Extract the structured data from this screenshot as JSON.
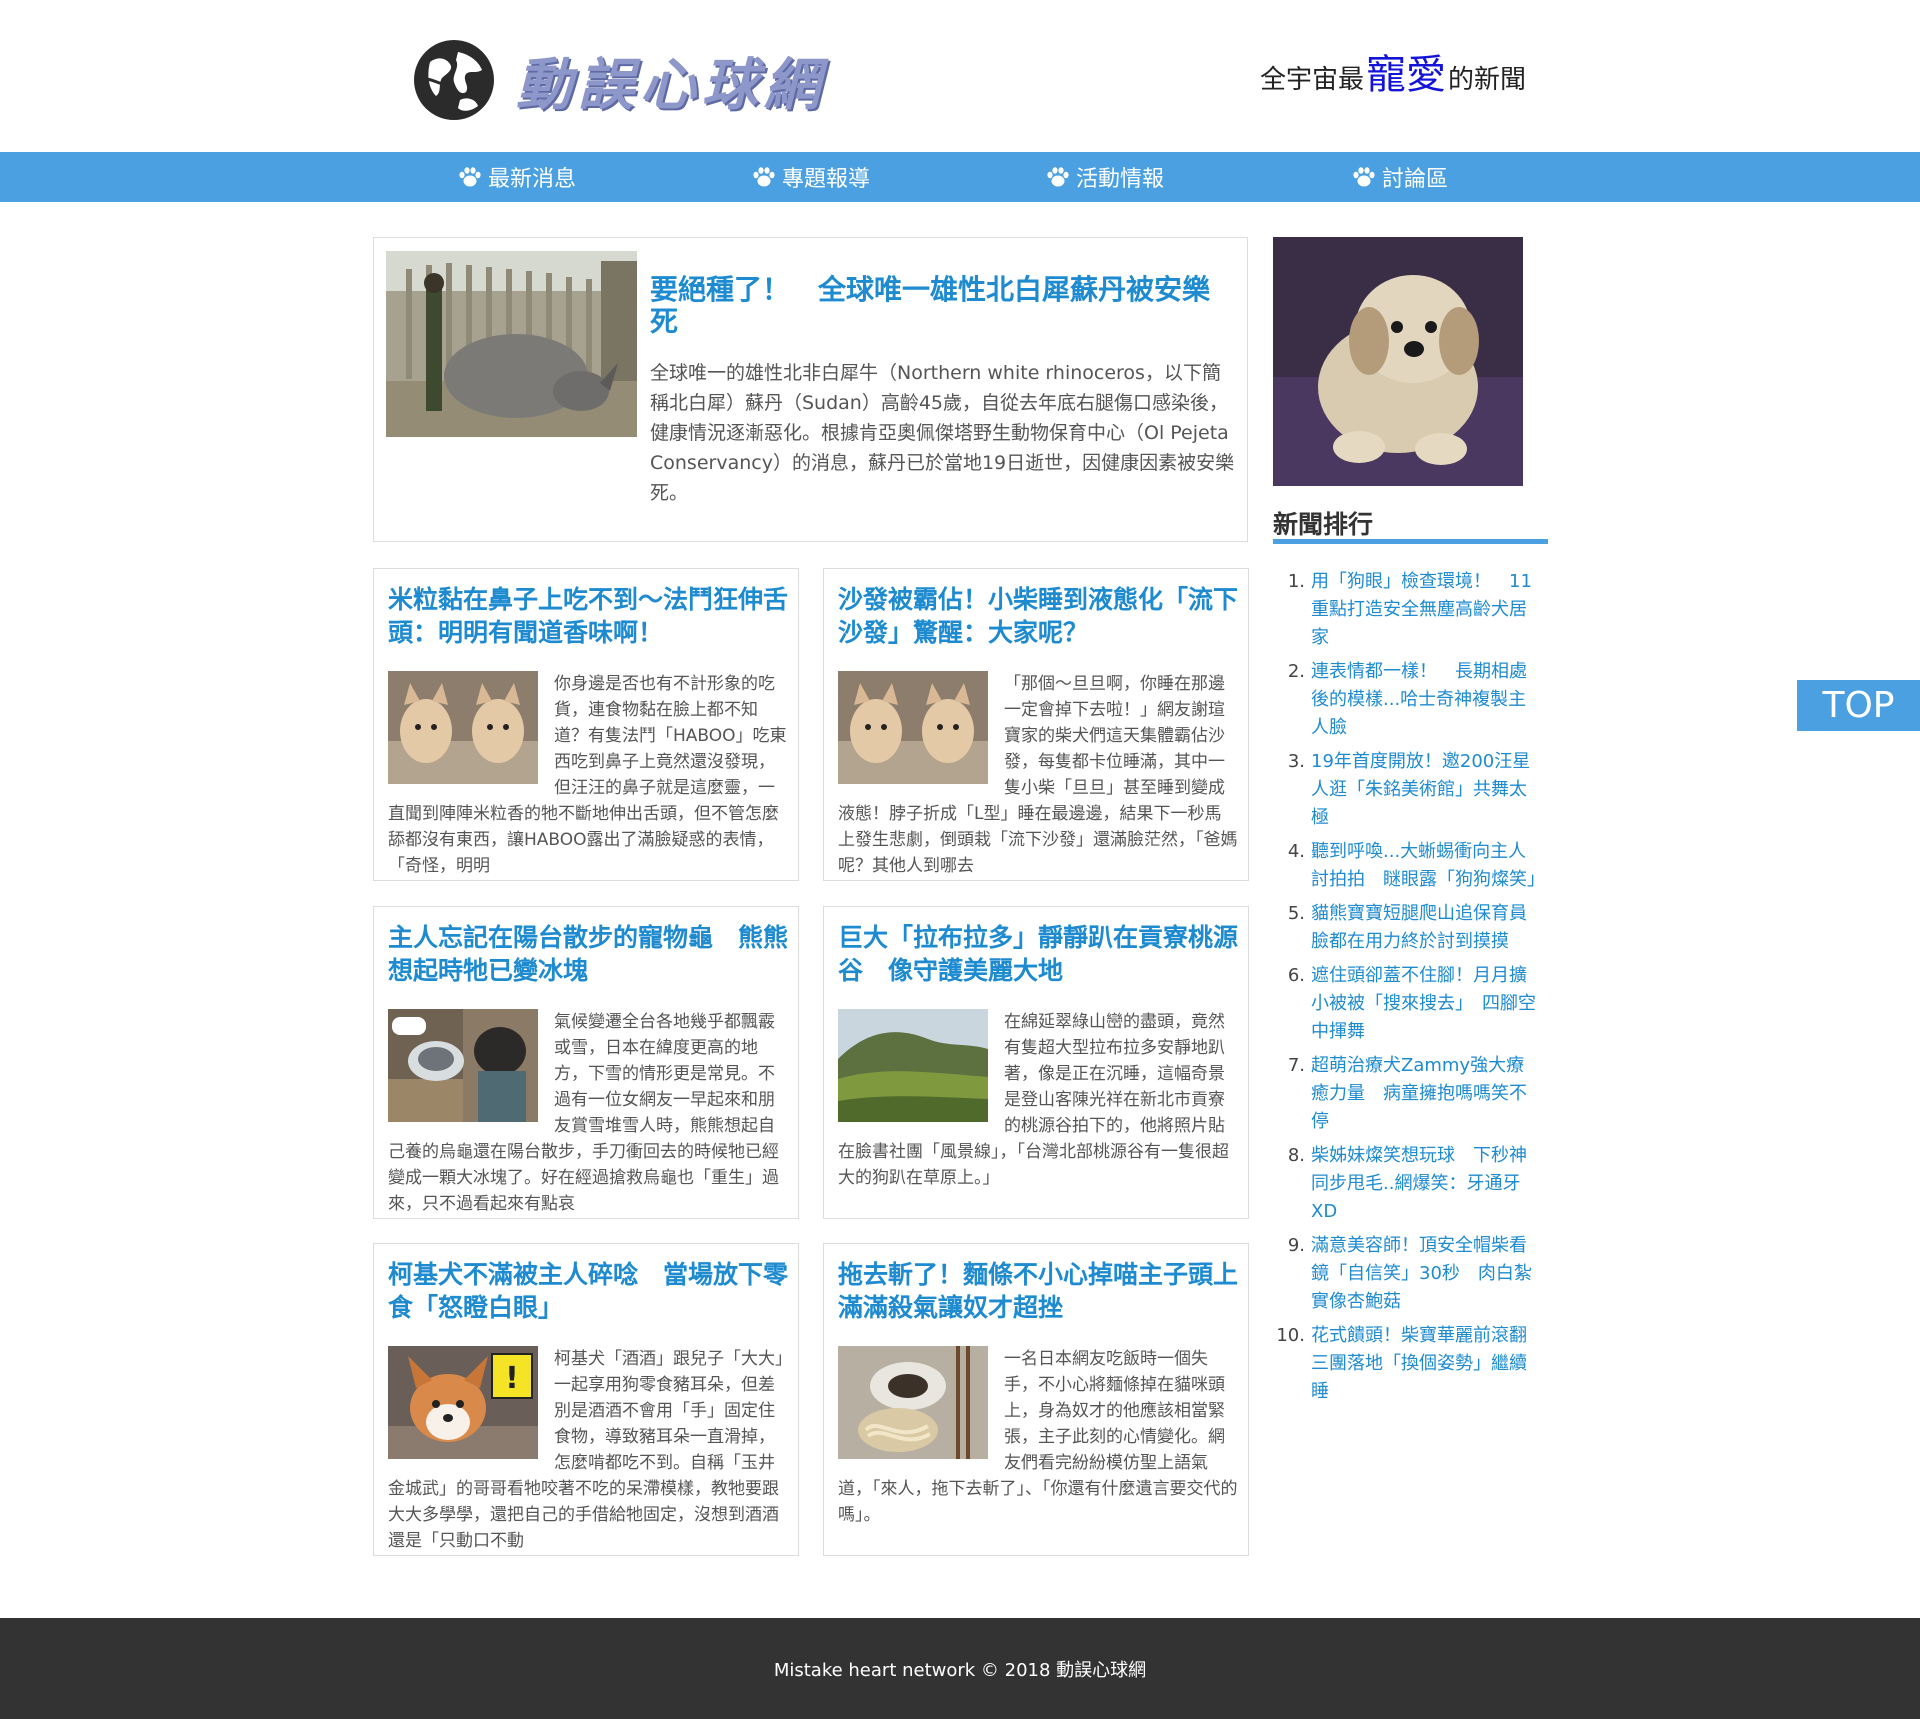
{
  "header": {
    "site_name": "動誤心球網",
    "slogan_prefix": "全宇宙最",
    "slogan_highlight": "寵愛",
    "slogan_suffix": "的新聞"
  },
  "nav": {
    "items": [
      {
        "label": "最新消息",
        "icon": "paw-icon"
      },
      {
        "label": "專題報導",
        "icon": "paw-icon"
      },
      {
        "label": "活動情報",
        "icon": "paw-icon"
      },
      {
        "label": "討論區",
        "icon": "paw-icon"
      }
    ]
  },
  "feature": {
    "title": "要絕種了！　全球唯一雄性北白犀蘇丹被安樂死",
    "text": "全球唯一的雄性北非白犀牛（Northern white rhinoceros，以下簡稱北白犀）蘇丹（Sudan）高齡45歲，自從去年底右腿傷口感染後，健康情況逐漸惡化。根據肯亞奧佩傑塔野生動物保育中心（Ol Pejeta Conservancy）的消息，蘇丹已於當地19日逝世，因健康因素被安樂死。"
  },
  "articles": [
    {
      "title": "米粒黏在鼻子上吃不到～法鬥狂伸舌頭：明明有聞道香味啊！",
      "text": "你身邊是否也有不計形象的吃貨，連食物黏在臉上都不知道？有隻法鬥「HABOO」吃東西吃到鼻子上竟然還沒發現，但汪汪的鼻子就是這麼靈，一直聞到陣陣米粒香的牠不斷地伸出舌頭，但不管怎麼舔都沒有東西，讓HABOO露出了滿臉疑惑的表情，「奇怪，明明"
    },
    {
      "title": "沙發被霸佔！小柴睡到液態化「流下沙發」驚醒：大家呢？",
      "text": "「那個～旦旦啊，你睡在那邊一定會掉下去啦！」網友謝瑄寶家的柴犬們這天集體霸佔沙發，每隻都卡位睡滿，其中一隻小柴「旦旦」甚至睡到變成液態！脖子折成「L型」睡在最邊邊，結果下一秒馬上發生悲劇，倒頭栽「流下沙發」還滿臉茫然，「爸媽呢？其他人到哪去"
    },
    {
      "title": "主人忘記在陽台散步的寵物龜　熊熊想起時牠已變冰塊",
      "text": "氣候變遷全台各地幾乎都飄霰或雪，日本在緯度更高的地方，下雪的情形更是常見。不過有一位女網友一早起來和朋友賞雪堆雪人時，熊熊想起自己養的烏龜還在陽台散步，手刀衝回去的時候牠已經變成一顆大冰塊了。好在經過搶救烏龜也「重生」過來，只不過看起來有點哀"
    },
    {
      "title": "巨大「拉布拉多」靜靜趴在貢寮桃源谷　像守護美麗大地",
      "text": "在綿延翠綠山巒的盡頭，竟然有隻超大型拉布拉多安靜地趴著，像是正在沉睡，這幅奇景是登山客陳光祥在新北市貢寮的桃源谷拍下的，他將照片貼在臉書社團「風景線」，「台灣北部桃源谷有一隻很超大的狗趴在草原上。」"
    },
    {
      "title": "柯基犬不滿被主人碎唸　當場放下零食「怒瞪白眼」",
      "text": "柯基犬「酒酒」跟兒子「大大」一起享用狗零食豬耳朵，但差別是酒酒不會用「手」固定住食物，導致豬耳朵一直滑掉，怎麼啃都吃不到。自稱「玉井金城武」的哥哥看牠咬著不吃的呆滯模樣，教牠要跟大大多學學，還把自己的手借給牠固定，沒想到酒酒還是「只動口不動"
    },
    {
      "title": "拖去斬了！麵條不小心掉喵主子頭上　滿滿殺氣讓奴才超挫",
      "text": "一名日本網友吃飯時一個失手，不小心將麵條掉在貓咪頭上，身為奴才的他應該相當緊張，主子此刻的心情變化。網友們看完紛紛模仿聖上語氣道，「來人，拖下去斬了」、「你還有什麼遺言要交代的嗎」。"
    }
  ],
  "sidebar": {
    "rank_title": "新聞排行",
    "rank_items": [
      "用「狗眼」檢查環境！　11重點打造安全無塵高齡犬居家",
      "連表情都一樣！　長期相處後的模樣...哈士奇神複製主人臉",
      "19年首度開放！邀200汪星人逛「朱銘美術館」共舞太極",
      "聽到呼喚...大蜥蜴衝向主人討拍拍　瞇眼露「狗狗燦笑」",
      "貓熊寶寶短腿爬山追保育員　臉都在用力終於討到摸摸",
      "遮住頭卻蓋不住腳！月月擴小被被「搜來搜去」　四腳空中揮舞",
      "超萌治療犬Zammy強大療癒力量　病童擁抱嗎嗎笑不停",
      "柴姊妹燦笑想玩球　下秒神同步甩毛..網爆笑：牙通牙XD",
      "滿意美容師！頂安全帽柴看鏡「自信笑」30秒　肉白紮實像杏鮑菇",
      "花式饋頭！柴寶華麗前滾翻　三團落地「換個姿勢」繼續睡"
    ]
  },
  "top_button": "TOP",
  "footer": "Mistake heart network © 2018 動誤心球網",
  "colors": {
    "nav_bg": "#4aa0e0",
    "title_blue": "#1e8bd0",
    "slogan_highlight": "#1414d8",
    "footer_bg": "#333333"
  }
}
